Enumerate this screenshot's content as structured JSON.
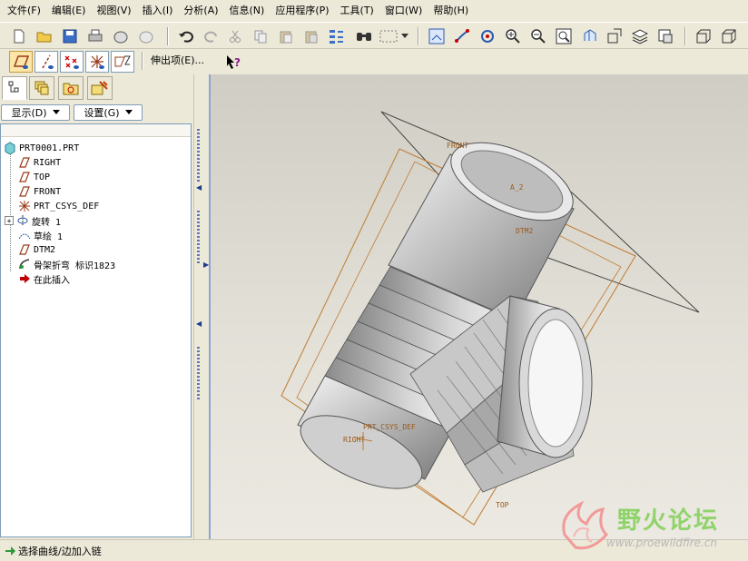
{
  "menubar": {
    "items": [
      "文件(F)",
      "编辑(E)",
      "视图(V)",
      "插入(I)",
      "分析(A)",
      "信息(N)",
      "应用程序(P)",
      "工具(T)",
      "窗口(W)",
      "帮助(H)"
    ]
  },
  "toolbar": {
    "icons": [
      "new-icon",
      "open-icon",
      "save-icon",
      "print-icon",
      "send-icon",
      "model-tree-icon",
      "undo-icon",
      "redo-icon",
      "cut-icon",
      "copy-icon",
      "paste-icon",
      "paste-special-icon",
      "regenerate-icon",
      "find-icon",
      "select-box-icon",
      "repaint-icon",
      "orient-icon",
      "spin-center-icon",
      "zoom-in-icon",
      "zoom-out-icon",
      "refit-icon",
      "reorient-icon",
      "named-views-icon",
      "layers-icon",
      "view-manager-icon",
      "shading-icon",
      "hidden-line-icon"
    ]
  },
  "filter_toolbar": {
    "extend_label": "伸出项(E)...",
    "help_icon": "context-help-icon"
  },
  "left_panel": {
    "tabs": [
      "model-tree-tab",
      "layer-tree-tab",
      "folder-browser-tab",
      "favorites-tab"
    ],
    "show_button": "显示(D)",
    "settings_button": "设置(G)",
    "tree": [
      {
        "label": "PRT0001.PRT",
        "icon": "part-icon"
      },
      {
        "label": "RIGHT",
        "icon": "datum-plane-icon"
      },
      {
        "label": "TOP",
        "icon": "datum-plane-icon"
      },
      {
        "label": "FRONT",
        "icon": "datum-plane-icon"
      },
      {
        "label": "PRT_CSYS_DEF",
        "icon": "csys-icon"
      },
      {
        "label": "旋转 1",
        "icon": "revolve-icon"
      },
      {
        "label": "草绘 1",
        "icon": "sketch-icon"
      },
      {
        "label": "DTM2",
        "icon": "datum-plane-icon"
      },
      {
        "label": "骨架折弯 标识1823",
        "icon": "spinal-bend-icon"
      },
      {
        "label": "在此插入",
        "icon": "insert-here-icon"
      }
    ]
  },
  "viewport": {
    "labels": {
      "front": "FRONT",
      "axis": "A_2",
      "dtm2": "DTM2",
      "csys": "PRT_CSYS_DEF",
      "right": "RIGHT",
      "top": "TOP"
    }
  },
  "statusbar": {
    "message": "选择曲线/边加入链"
  },
  "watermark": {
    "title": "野火论坛",
    "url": "www.proewildfire.cn"
  },
  "colors": {
    "background": "#ece9d8",
    "datum": "#9a5a1c",
    "selection": "#1c3c8c"
  }
}
